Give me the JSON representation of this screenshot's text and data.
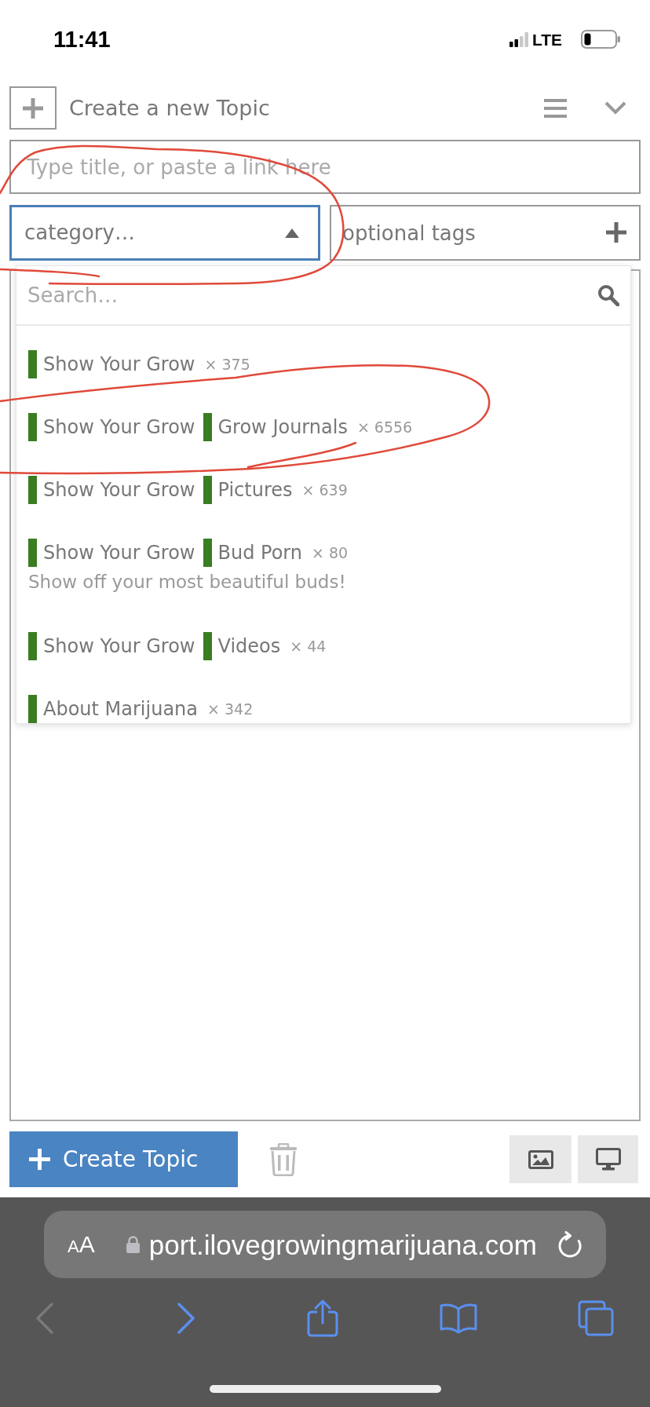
{
  "status_bar": {
    "time": "11:41",
    "network": "LTE"
  },
  "composer": {
    "title": "Create a new Topic",
    "title_field": {
      "placeholder": "Type title, or paste a link here"
    },
    "category_select": {
      "value": "category…",
      "expanded": true
    },
    "tags_field": {
      "placeholder": "optional tags"
    }
  },
  "category_dropdown": {
    "search": {
      "placeholder": "Search…"
    },
    "items": [
      {
        "categories": [
          {
            "name": "Show Your Grow"
          }
        ],
        "count": "× 375"
      },
      {
        "categories": [
          {
            "name": "Show Your Grow"
          },
          {
            "name": "Grow Journals"
          }
        ],
        "count": "× 6556"
      },
      {
        "categories": [
          {
            "name": "Show Your Grow"
          },
          {
            "name": "Pictures"
          }
        ],
        "count": "× 639"
      },
      {
        "categories": [
          {
            "name": "Show Your Grow"
          },
          {
            "name": "Bud Porn"
          }
        ],
        "count": "× 80",
        "description": "Show off your most beautiful buds!"
      },
      {
        "categories": [
          {
            "name": "Show Your Grow"
          },
          {
            "name": "Videos"
          }
        ],
        "count": "× 44"
      },
      {
        "categories": [
          {
            "name": "About Marijuana"
          }
        ],
        "count": "× 342"
      }
    ]
  },
  "footer": {
    "create_button": "Create Topic"
  },
  "browser": {
    "text_size_button": "AA",
    "url": "port.ilovegrowingmarijuana.com",
    "back": {
      "disabled": true
    }
  },
  "annotations": [
    {
      "kind": "freehand_loop"
    },
    {
      "kind": "freehand_loop"
    }
  ]
}
